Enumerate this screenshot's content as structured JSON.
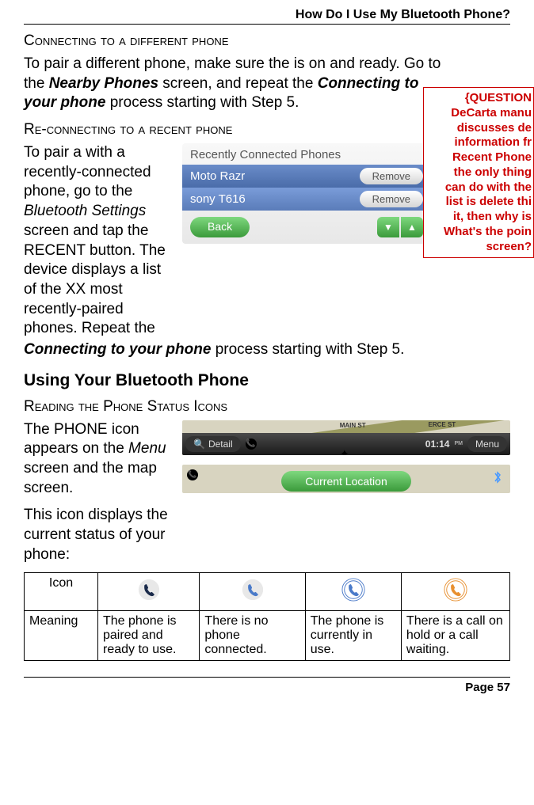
{
  "header": {
    "title": "How Do I Use My Bluetooth Phone?"
  },
  "section1": {
    "heading": "Connecting to a different phone",
    "body_pre": "To pair a different phone, make sure the is on and ready. Go to the ",
    "body_em1": "Nearby Phones",
    "body_mid1": " screen, and repeat the ",
    "body_em2": "Connecting to your phone",
    "body_post": " process starting with Step 5."
  },
  "callout": {
    "l1": "{QUESTION",
    "l2": "DeCarta manu",
    "l3": "discusses de",
    "l4": "information fr",
    "l5": "Recent Phone",
    "l6": "the only thing",
    "l7": "can do with the",
    "l8": "list is delete thi",
    "l9": "it, then why is",
    "l10": "What's the poin",
    "l11": "screen?"
  },
  "section2": {
    "heading": "Re-connecting to a recent phone",
    "body_pre": "To pair a with a recently-connected phone, go to the ",
    "body_em1": "Bluetooth Settings",
    "body_mid1": " screen and tap the ",
    "body_bold1": "RECENT",
    "body_mid2": " button. The device displays a list of the XX most recently-paired phones. Repeat the ",
    "body_em2": "Connecting to your phone",
    "body_post": " process starting with Step 5."
  },
  "recent_screen": {
    "title": "Recently Connected Phones",
    "row1_name": "Moto Razr",
    "row2_name": "sony T616",
    "remove_label": "Remove",
    "back_label": "Back"
  },
  "section3": {
    "heading": "Using Your Bluetooth Phone"
  },
  "section4": {
    "heading": "Reading the Phone Status Icons",
    "body_pre": "The ",
    "body_bold1": "PHONE",
    "body_mid1": " icon appears on the ",
    "body_em1": "Menu",
    "body_post1": " screen and the map screen.",
    "body2": "This icon displays the current status of your phone:"
  },
  "map_screen": {
    "detail_label": "Detail",
    "street1": "MAIN ST",
    "street2": "ERCE ST",
    "time": "01:14",
    "time_suffix": "PM",
    "menu_label": "Menu",
    "location_label": "Current Location"
  },
  "icon_table": {
    "header_icon": "Icon",
    "header_meaning": "Meaning",
    "m1": "The phone is paired and ready to use.",
    "m2": "There is no phone connected.",
    "m3": "The phone is currently in use.",
    "m4": "There is a call on hold or a call waiting."
  },
  "footer": {
    "page": "Page 57"
  },
  "chart_data": {
    "type": "table",
    "title": "Phone Status Icons",
    "columns": [
      "Icon",
      "Meaning"
    ],
    "rows": [
      {
        "icon": "phone-dark-navy",
        "meaning": "The phone is paired and ready to use."
      },
      {
        "icon": "phone-blue",
        "meaning": "There is no phone connected."
      },
      {
        "icon": "phone-blue-ring",
        "meaning": "The phone is currently in use."
      },
      {
        "icon": "phone-orange-ring",
        "meaning": "There is a call on hold or a call waiting."
      }
    ]
  }
}
